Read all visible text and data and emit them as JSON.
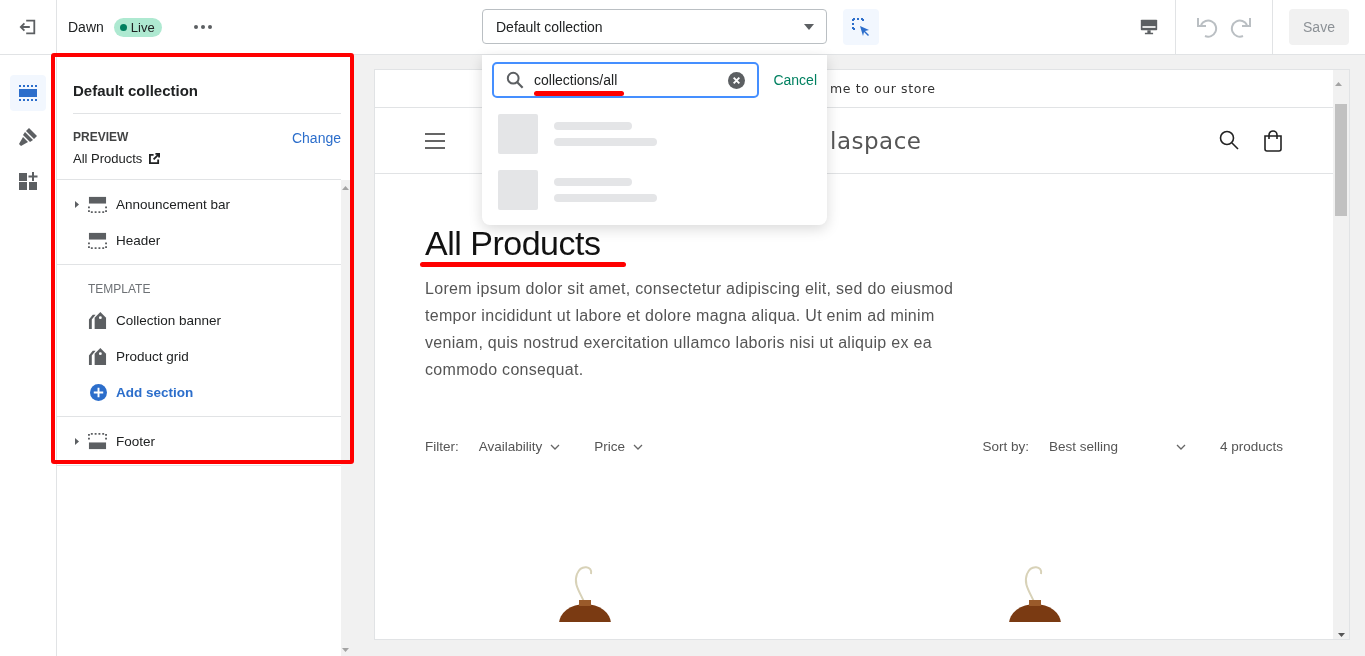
{
  "topbar": {
    "theme": "Dawn",
    "status": "Live",
    "template_select": "Default collection",
    "save_button": {
      "label": "Save",
      "disabled": true
    }
  },
  "rail": [
    {
      "kind": "sections",
      "selected": true
    },
    {
      "kind": "theme",
      "selected": false
    },
    {
      "kind": "apps",
      "selected": false
    }
  ],
  "sidebar": {
    "title": "Default collection",
    "preview_label": "PREVIEW",
    "change_link": "Change",
    "preview_value": "All Products",
    "groups": [
      {
        "items": [
          {
            "label": "Announcement bar",
            "kind": "header",
            "expandable": true
          },
          {
            "label": "Header",
            "kind": "header",
            "expandable": false
          }
        ]
      },
      {
        "title": "TEMPLATE",
        "items": [
          {
            "label": "Collection banner",
            "kind": "template",
            "expandable": false
          },
          {
            "label": "Product grid",
            "kind": "template",
            "expandable": false
          }
        ],
        "add_link": "Add section"
      },
      {
        "items": [
          {
            "label": "Footer",
            "kind": "footer",
            "expandable": true
          }
        ]
      }
    ]
  },
  "popover": {
    "search": "collections/all",
    "cancel": "Cancel",
    "results": [
      {
        "kind": "skeleton"
      },
      {
        "kind": "skeleton"
      }
    ]
  },
  "preview": {
    "announcement": "me to our store",
    "store_name": "laspace",
    "title": "All Products",
    "description": "Lorem ipsum dolor sit amet, consectetur adipiscing elit, sed do eiusmod tempor incididunt ut labore et dolore magna aliqua. Ut enim ad minim veniam, quis nostrud exercitation ullamco laboris nisi ut aliquip ex ea commodo consequat.",
    "filter_label": "Filter:",
    "filters": [
      "Availability",
      "Price"
    ],
    "sort_label": "Sort by:",
    "sort_value": "Best selling",
    "count": "4 products",
    "products": [
      {
        "kind": "picture"
      },
      {
        "kind": "picture"
      }
    ]
  }
}
